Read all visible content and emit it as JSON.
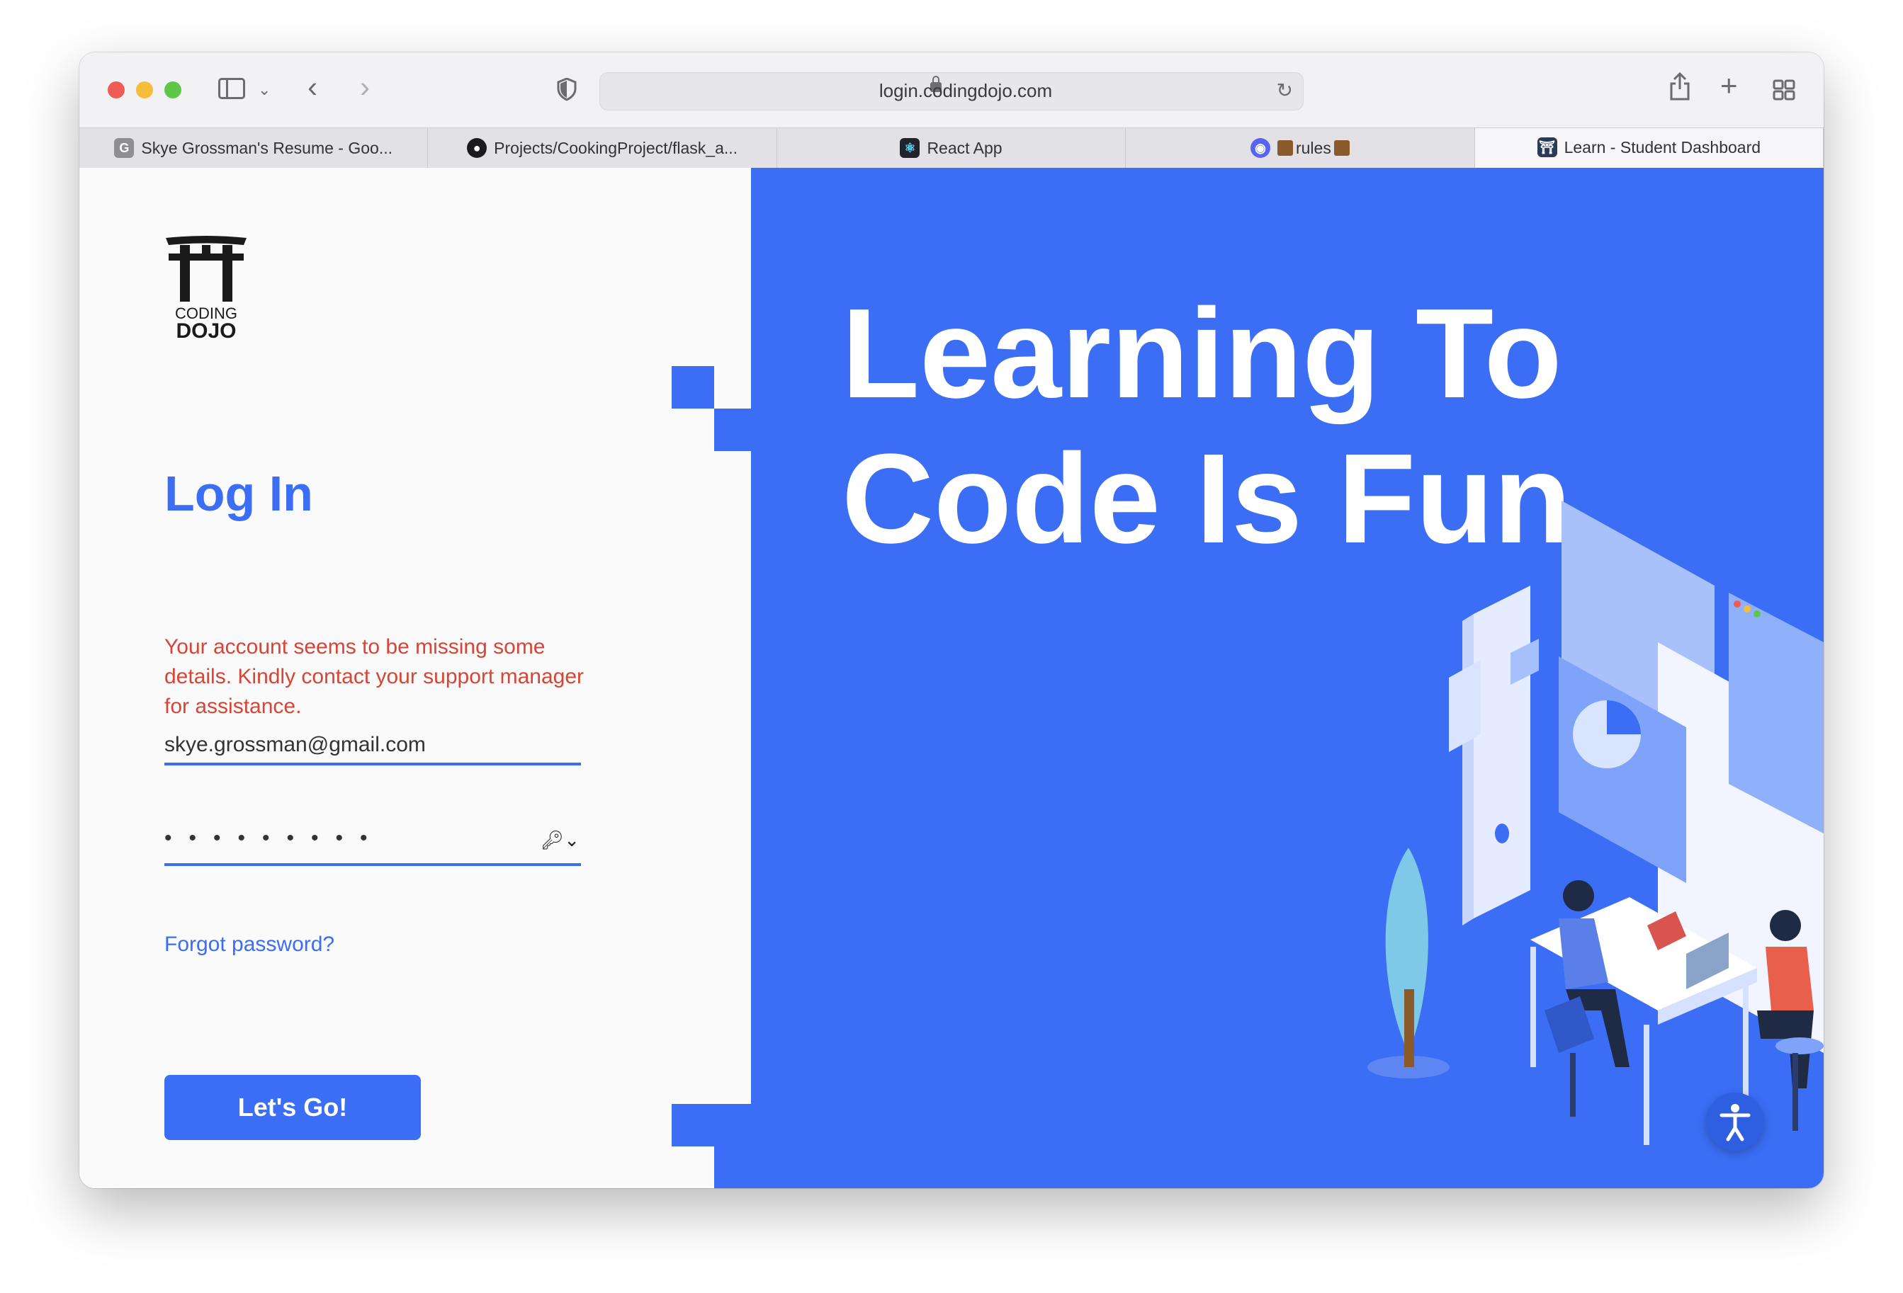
{
  "browser": {
    "url": "login.codingdojo.com",
    "tabs": [
      {
        "label": "Skye Grossman's Resume - Goo...",
        "icon": "google-docs-icon",
        "active": false
      },
      {
        "label": "Projects/CookingProject/flask_a...",
        "icon": "github-icon",
        "active": false
      },
      {
        "label": "React App",
        "icon": "react-icon",
        "active": false
      },
      {
        "label": "rules",
        "icon": "discord-icon",
        "active": false
      },
      {
        "label": "Learn - Student Dashboard",
        "icon": "coding-dojo-icon",
        "active": true
      }
    ]
  },
  "page": {
    "logo_text_top": "CODING",
    "logo_text_bottom": "DOJO",
    "title": "Log In",
    "error": "Your account seems to be missing some details. Kindly contact your support manager for assistance.",
    "email_value": "skye.grossman@gmail.com",
    "password_mask": "•••••••••",
    "forgot_label": "Forgot password?",
    "submit_label": "Let's Go!",
    "headline": "Learning To Code Is Fun."
  },
  "colors": {
    "brand_blue": "#3b6ef5",
    "error_red": "#d64535"
  }
}
